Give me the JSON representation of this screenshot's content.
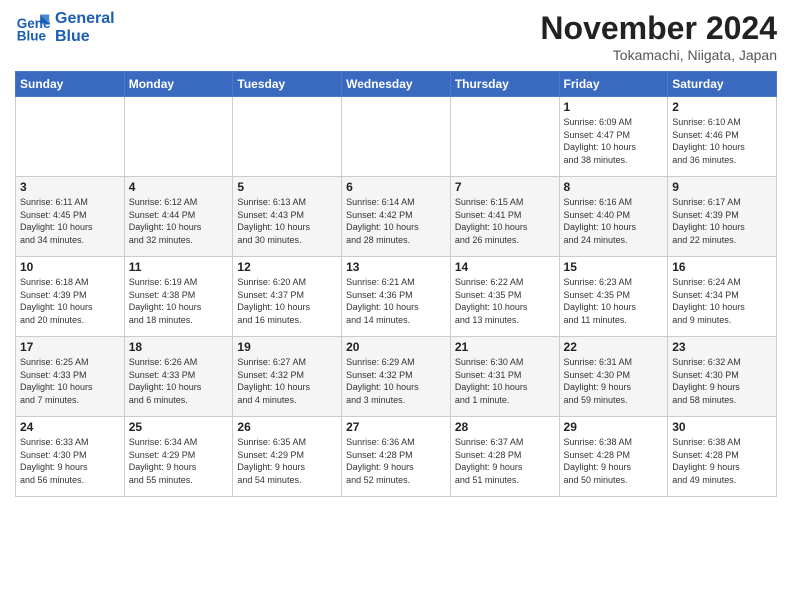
{
  "logo": {
    "line1": "General",
    "line2": "Blue"
  },
  "title": "November 2024",
  "location": "Tokamachi, Niigata, Japan",
  "weekdays": [
    "Sunday",
    "Monday",
    "Tuesday",
    "Wednesday",
    "Thursday",
    "Friday",
    "Saturday"
  ],
  "weeks": [
    [
      {
        "day": "",
        "info": ""
      },
      {
        "day": "",
        "info": ""
      },
      {
        "day": "",
        "info": ""
      },
      {
        "day": "",
        "info": ""
      },
      {
        "day": "",
        "info": ""
      },
      {
        "day": "1",
        "info": "Sunrise: 6:09 AM\nSunset: 4:47 PM\nDaylight: 10 hours\nand 38 minutes."
      },
      {
        "day": "2",
        "info": "Sunrise: 6:10 AM\nSunset: 4:46 PM\nDaylight: 10 hours\nand 36 minutes."
      }
    ],
    [
      {
        "day": "3",
        "info": "Sunrise: 6:11 AM\nSunset: 4:45 PM\nDaylight: 10 hours\nand 34 minutes."
      },
      {
        "day": "4",
        "info": "Sunrise: 6:12 AM\nSunset: 4:44 PM\nDaylight: 10 hours\nand 32 minutes."
      },
      {
        "day": "5",
        "info": "Sunrise: 6:13 AM\nSunset: 4:43 PM\nDaylight: 10 hours\nand 30 minutes."
      },
      {
        "day": "6",
        "info": "Sunrise: 6:14 AM\nSunset: 4:42 PM\nDaylight: 10 hours\nand 28 minutes."
      },
      {
        "day": "7",
        "info": "Sunrise: 6:15 AM\nSunset: 4:41 PM\nDaylight: 10 hours\nand 26 minutes."
      },
      {
        "day": "8",
        "info": "Sunrise: 6:16 AM\nSunset: 4:40 PM\nDaylight: 10 hours\nand 24 minutes."
      },
      {
        "day": "9",
        "info": "Sunrise: 6:17 AM\nSunset: 4:39 PM\nDaylight: 10 hours\nand 22 minutes."
      }
    ],
    [
      {
        "day": "10",
        "info": "Sunrise: 6:18 AM\nSunset: 4:39 PM\nDaylight: 10 hours\nand 20 minutes."
      },
      {
        "day": "11",
        "info": "Sunrise: 6:19 AM\nSunset: 4:38 PM\nDaylight: 10 hours\nand 18 minutes."
      },
      {
        "day": "12",
        "info": "Sunrise: 6:20 AM\nSunset: 4:37 PM\nDaylight: 10 hours\nand 16 minutes."
      },
      {
        "day": "13",
        "info": "Sunrise: 6:21 AM\nSunset: 4:36 PM\nDaylight: 10 hours\nand 14 minutes."
      },
      {
        "day": "14",
        "info": "Sunrise: 6:22 AM\nSunset: 4:35 PM\nDaylight: 10 hours\nand 13 minutes."
      },
      {
        "day": "15",
        "info": "Sunrise: 6:23 AM\nSunset: 4:35 PM\nDaylight: 10 hours\nand 11 minutes."
      },
      {
        "day": "16",
        "info": "Sunrise: 6:24 AM\nSunset: 4:34 PM\nDaylight: 10 hours\nand 9 minutes."
      }
    ],
    [
      {
        "day": "17",
        "info": "Sunrise: 6:25 AM\nSunset: 4:33 PM\nDaylight: 10 hours\nand 7 minutes."
      },
      {
        "day": "18",
        "info": "Sunrise: 6:26 AM\nSunset: 4:33 PM\nDaylight: 10 hours\nand 6 minutes."
      },
      {
        "day": "19",
        "info": "Sunrise: 6:27 AM\nSunset: 4:32 PM\nDaylight: 10 hours\nand 4 minutes."
      },
      {
        "day": "20",
        "info": "Sunrise: 6:29 AM\nSunset: 4:32 PM\nDaylight: 10 hours\nand 3 minutes."
      },
      {
        "day": "21",
        "info": "Sunrise: 6:30 AM\nSunset: 4:31 PM\nDaylight: 10 hours\nand 1 minute."
      },
      {
        "day": "22",
        "info": "Sunrise: 6:31 AM\nSunset: 4:30 PM\nDaylight: 9 hours\nand 59 minutes."
      },
      {
        "day": "23",
        "info": "Sunrise: 6:32 AM\nSunset: 4:30 PM\nDaylight: 9 hours\nand 58 minutes."
      }
    ],
    [
      {
        "day": "24",
        "info": "Sunrise: 6:33 AM\nSunset: 4:30 PM\nDaylight: 9 hours\nand 56 minutes."
      },
      {
        "day": "25",
        "info": "Sunrise: 6:34 AM\nSunset: 4:29 PM\nDaylight: 9 hours\nand 55 minutes."
      },
      {
        "day": "26",
        "info": "Sunrise: 6:35 AM\nSunset: 4:29 PM\nDaylight: 9 hours\nand 54 minutes."
      },
      {
        "day": "27",
        "info": "Sunrise: 6:36 AM\nSunset: 4:28 PM\nDaylight: 9 hours\nand 52 minutes."
      },
      {
        "day": "28",
        "info": "Sunrise: 6:37 AM\nSunset: 4:28 PM\nDaylight: 9 hours\nand 51 minutes."
      },
      {
        "day": "29",
        "info": "Sunrise: 6:38 AM\nSunset: 4:28 PM\nDaylight: 9 hours\nand 50 minutes."
      },
      {
        "day": "30",
        "info": "Sunrise: 6:38 AM\nSunset: 4:28 PM\nDaylight: 9 hours\nand 49 minutes."
      }
    ]
  ]
}
